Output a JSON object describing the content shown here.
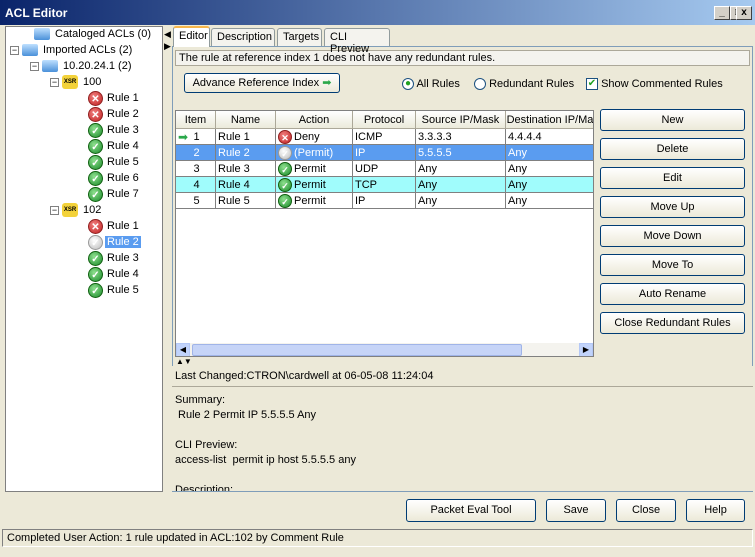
{
  "window": {
    "title": "ACL Editor",
    "min": "_",
    "max": "□",
    "close": "x"
  },
  "tree": {
    "cataloged": "Cataloged ACLs (0)",
    "imported": "Imported ACLs (2)",
    "device": "10.20.24.1 (2)",
    "acls": [
      {
        "name": "100",
        "rules": [
          {
            "label": "Rule 1",
            "state": "deny"
          },
          {
            "label": "Rule 2",
            "state": "deny"
          },
          {
            "label": "Rule 3",
            "state": "permit"
          },
          {
            "label": "Rule 4",
            "state": "permit"
          },
          {
            "label": "Rule 5",
            "state": "permit"
          },
          {
            "label": "Rule 6",
            "state": "permit"
          },
          {
            "label": "Rule 7",
            "state": "permit"
          }
        ]
      },
      {
        "name": "102",
        "rules": [
          {
            "label": "Rule 1",
            "state": "deny"
          },
          {
            "label": "Rule 2",
            "state": "disabled",
            "selected": true
          },
          {
            "label": "Rule 3",
            "state": "permit"
          },
          {
            "label": "Rule 4",
            "state": "permit"
          },
          {
            "label": "Rule 5",
            "state": "permit"
          }
        ]
      }
    ]
  },
  "tabs": [
    "Editor",
    "Description",
    "Targets",
    "CLI Preview"
  ],
  "message": "The rule at reference index 1 does not have any redundant rules.",
  "advance_button": "Advance Reference Index",
  "filters": {
    "all": "All Rules",
    "redundant": "Redundant Rules",
    "commented": "Show Commented Rules",
    "selected": "all",
    "show_commented": true
  },
  "table": {
    "columns": [
      "Item",
      "Name",
      "Action",
      "Protocol",
      "Source IP/Mask",
      "Destination IP/Mask"
    ],
    "rows": [
      {
        "item": "1",
        "name": "Rule 1",
        "action": "Deny",
        "state": "deny",
        "protocol": "ICMP",
        "src": "3.3.3.3",
        "dst": "4.4.4.4",
        "current": true
      },
      {
        "item": "2",
        "name": "Rule 2",
        "action": "(Permit)",
        "state": "disabled",
        "protocol": "IP",
        "src": "5.5.5.5",
        "dst": "Any",
        "highlight": "selected"
      },
      {
        "item": "3",
        "name": "Rule 3",
        "action": "Permit",
        "state": "permit",
        "protocol": "UDP",
        "src": "Any",
        "dst": "Any"
      },
      {
        "item": "4",
        "name": "Rule 4",
        "action": "Permit",
        "state": "permit",
        "protocol": "TCP",
        "src": "Any",
        "dst": "Any",
        "highlight": "cyan"
      },
      {
        "item": "5",
        "name": "Rule 5",
        "action": "Permit",
        "state": "permit",
        "protocol": "IP",
        "src": "Any",
        "dst": "Any"
      }
    ]
  },
  "side_buttons": [
    "New",
    "Delete",
    "Edit",
    "Move Up",
    "Move Down",
    "Move To",
    "Auto Rename",
    "Close Redundant Rules"
  ],
  "info": {
    "last_changed": "Last Changed:CTRON\\cardwell at 06-05-08 11:24:04",
    "summary_label": "Summary:",
    "summary": " Rule 2 Permit IP 5.5.5.5 Any",
    "cli_label": "CLI Preview:",
    "cli": "access-list  permit ip host 5.5.5.5 any",
    "desc_label": "Description:"
  },
  "bottom_buttons": {
    "packet_eval": "Packet Eval Tool",
    "save": "Save",
    "close": "Close",
    "help": "Help"
  },
  "status": "Completed User Action: 1 rule updated in ACL:102 by Comment Rule",
  "colors": {
    "selected": "#5a9cf0",
    "cyan": "#a0fcfc",
    "title": "#0a246a"
  }
}
